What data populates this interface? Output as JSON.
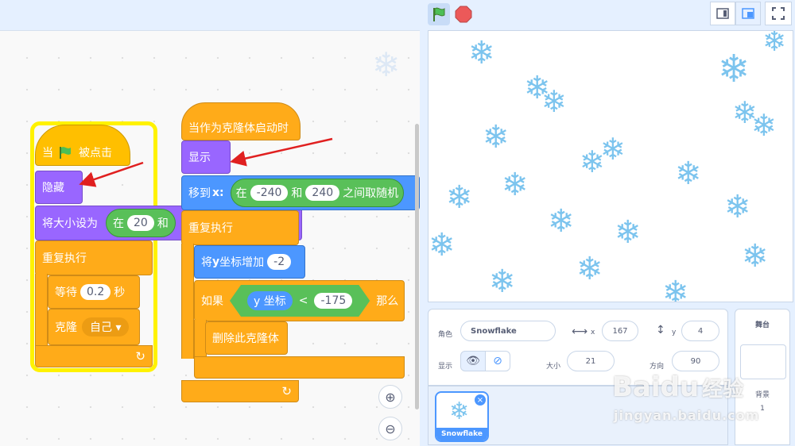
{
  "stage_controls": {
    "green_flag": "green-flag",
    "stop": "stop-sign"
  },
  "scripts": {
    "script1": {
      "hat": {
        "label1": "当",
        "label2": "被点击"
      },
      "hide": "隐藏",
      "set_size": {
        "label": "将大小设为",
        "op_label1": "在",
        "value": "20",
        "op_label2": "和"
      },
      "forever": "重复执行",
      "wait": {
        "label": "等待",
        "value": "0.2",
        "unit": "秒"
      },
      "clone": {
        "label": "克隆",
        "target": "自己"
      }
    },
    "script2": {
      "hat": "当作为克隆体启动时",
      "show": "显示",
      "goto": {
        "label": "移到",
        "axis": "x:",
        "op_label1": "在",
        "from": "-240",
        "op_label2": "和",
        "to": "240",
        "op_label3": "之间取随机"
      },
      "forever": "重复执行",
      "change_y": {
        "label_pre": "将",
        "label_y": "y",
        "label_post": "坐标增加",
        "value": "-2"
      },
      "if_block": {
        "label_if": "如果",
        "var": "y 坐标",
        "op": "<",
        "value": "-175",
        "label_then": "那么"
      },
      "delete": "删除此克隆体"
    }
  },
  "sprite_info": {
    "sprite_label": "角色",
    "sprite_name": "Snowflake",
    "x_label": "x",
    "x_value": "167",
    "y_label": "y",
    "y_value": "4",
    "show_label": "显示",
    "size_label": "大小",
    "size_value": "21",
    "direction_label": "方向",
    "direction_value": "90"
  },
  "sprites": [
    {
      "name": "Snowflake"
    }
  ],
  "stage_panel": {
    "title": "舞台",
    "backdrops_label": "背景",
    "backdrops_count": "1"
  },
  "watermark": {
    "logo_text": "Bai",
    "logo_paw": "du",
    "logo_cn": "经验",
    "url": "jingyan.baidu.com"
  },
  "colors": {
    "events": "#ffbf00",
    "control": "#ffab19",
    "looks": "#9966ff",
    "motion": "#4c97ff",
    "operators": "#59c059",
    "highlight": "#fff200",
    "flake": "#7cc4ee"
  }
}
